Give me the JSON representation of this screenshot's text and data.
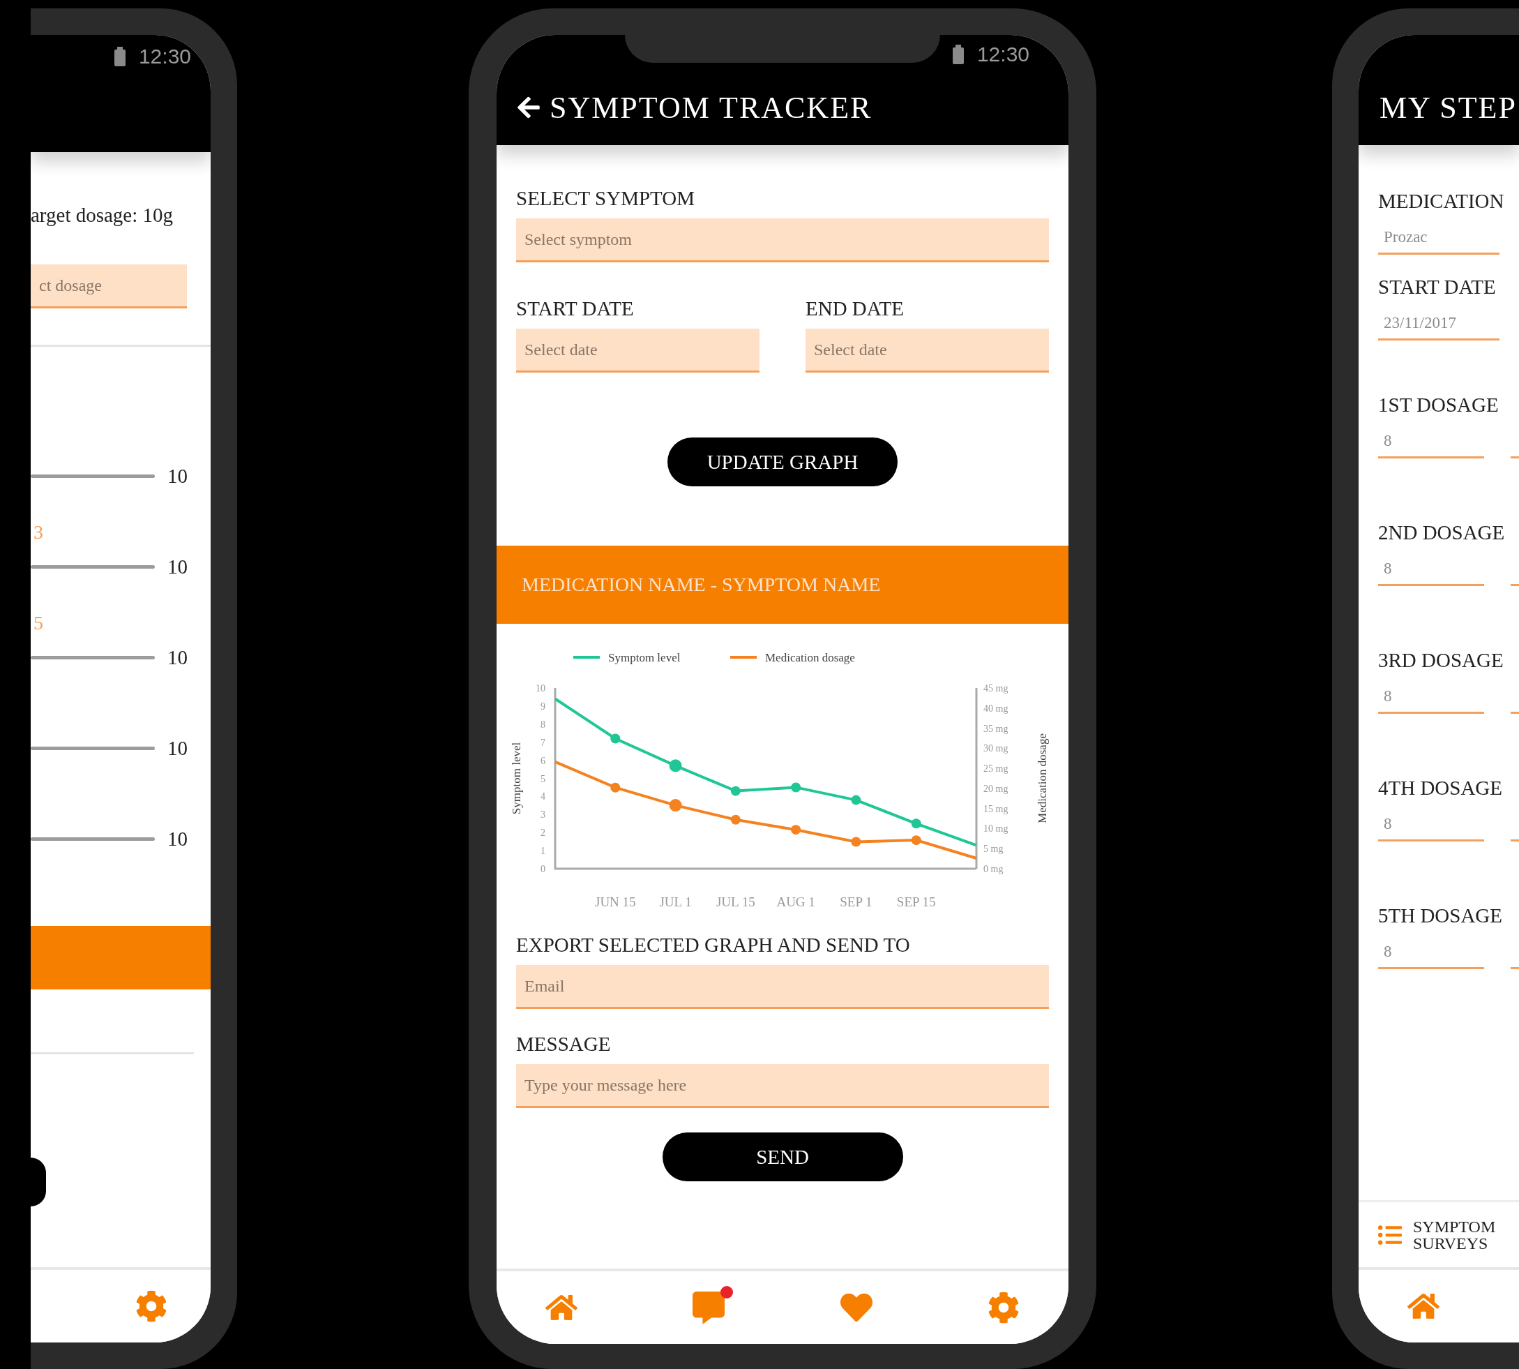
{
  "left_phone": {
    "status_time": "12:30",
    "target_text": "arget dosage: 10g",
    "dosage_field": {
      "placeholder": "ct dosage"
    },
    "sliders": [
      {
        "max": "10"
      },
      {
        "value": "3",
        "max": "10"
      },
      {
        "value": "5",
        "max": "10"
      },
      {
        "max": "10"
      },
      {
        "max": "10"
      }
    ],
    "nav": [
      {
        "kind": "settings"
      }
    ]
  },
  "center_phone": {
    "status_time": "12:30",
    "title": "SYMPTOM TRACKER",
    "symptom": {
      "label": "SELECT SYMPTOM",
      "placeholder": "Select symptom"
    },
    "dates": [
      {
        "label": "START DATE",
        "placeholder": "Select date"
      },
      {
        "label": "END DATE",
        "placeholder": "Select date"
      }
    ],
    "update_button": "UPDATE GRAPH",
    "banner": "MEDICATION NAME - SYMPTOM NAME",
    "chart_data": {
      "type": "line",
      "legend": true,
      "ylabel": "Symptom level",
      "y2label": "Medication dosage",
      "categories": [
        null,
        "JUN 15",
        "JUL 1",
        "JUL 15",
        "AUG 1",
        "SEP 1",
        "SEP 15",
        null
      ],
      "ylim": [
        0,
        10
      ],
      "yticks": [
        0,
        1,
        2,
        3,
        4,
        5,
        6,
        7,
        8,
        9,
        10
      ],
      "y2lim": [
        0,
        45
      ],
      "y2ticks": [
        {
          "value": 0,
          "label": "0 mg"
        },
        {
          "value": 5,
          "label": "5 mg"
        },
        {
          "value": 10,
          "label": "10 mg"
        },
        {
          "value": 15,
          "label": "15 mg"
        },
        {
          "value": 20,
          "label": "20 mg"
        },
        {
          "value": 25,
          "label": "25 mg"
        },
        {
          "value": 30,
          "label": "30 mg"
        },
        {
          "value": 35,
          "label": "35 mg"
        },
        {
          "value": 40,
          "label": "40 mg"
        },
        {
          "value": 45,
          "label": "45 mg"
        }
      ],
      "series": [
        {
          "name": "Symptom level",
          "color": "#1fc796",
          "axis": "y",
          "values": [
            9.4,
            7.2,
            5.7,
            4.3,
            4.5,
            3.8,
            2.5,
            1.3
          ]
        },
        {
          "name": "Medication dosage",
          "color": "#f58220",
          "axis": "y2",
          "values": [
            26.6,
            20.2,
            15.8,
            12.2,
            9.7,
            6.7,
            7.1,
            2.6
          ]
        }
      ]
    },
    "export": {
      "label": "EXPORT SELECTED GRAPH AND SEND TO",
      "placeholder": "Email"
    },
    "message": {
      "label": "MESSAGE",
      "placeholder": "Type your message here"
    },
    "send_button": "SEND",
    "nav": [
      {
        "kind": "home"
      },
      {
        "kind": "chat",
        "notification": true
      },
      {
        "kind": "heart"
      },
      {
        "kind": "settings"
      }
    ]
  },
  "right_phone": {
    "title": "MY STEP",
    "medication": {
      "label": "MEDICATION",
      "value": "Prozac"
    },
    "start_date": {
      "label": "START DATE",
      "value": "23/11/2017"
    },
    "dosages": [
      {
        "label": "1ST DOSAGE",
        "value": "8"
      },
      {
        "label": "2ND DOSAGE",
        "value": "8"
      },
      {
        "label": "3RD DOSAGE",
        "value": "8"
      },
      {
        "label": "4TH DOSAGE",
        "value": "8"
      },
      {
        "label": "5TH DOSAGE",
        "value": "8"
      }
    ],
    "tab": {
      "label": "SYMPTOM SURVEYS"
    },
    "nav": [
      {
        "kind": "home"
      }
    ]
  }
}
